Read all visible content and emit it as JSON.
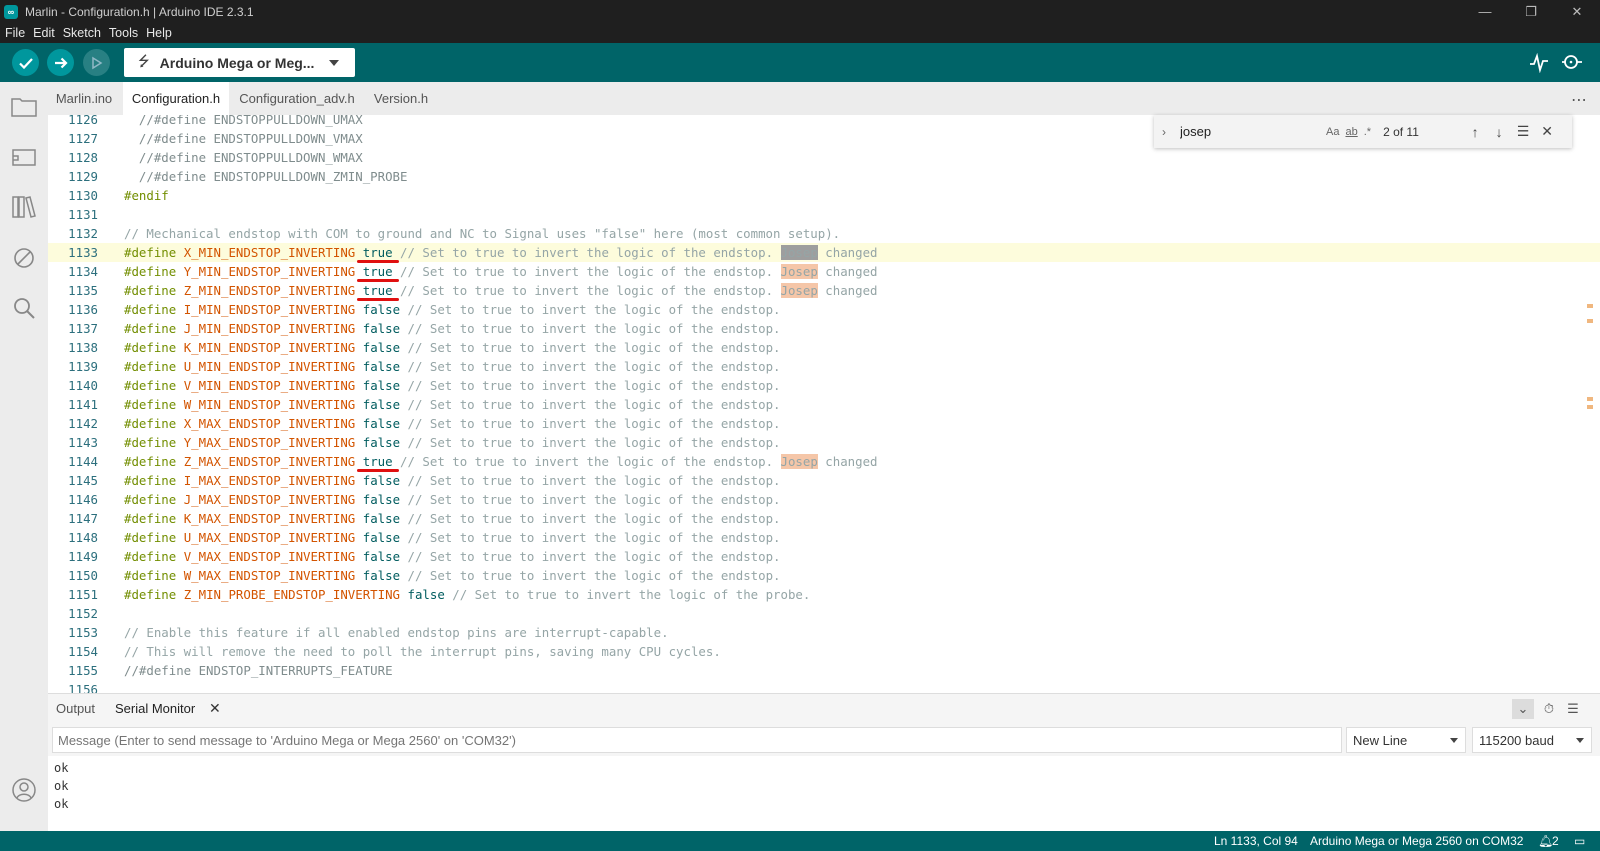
{
  "window": {
    "title": "Marlin - Configuration.h | Arduino IDE 2.3.1"
  },
  "menu": [
    "File",
    "Edit",
    "Sketch",
    "Tools",
    "Help"
  ],
  "toolbar": {
    "board": "Arduino Mega or Meg..."
  },
  "tabs": [
    "Marlin.ino",
    "Configuration.h",
    "Configuration_adv.h",
    "Version.h"
  ],
  "active_tab": "Configuration.h",
  "find": {
    "query": "josep",
    "count": "2 of 11",
    "case_label": "Aa",
    "word_label": "ab",
    "regex_label": ".*"
  },
  "editor": {
    "lines": [
      {
        "n": "1126",
        "segs": [
          {
            "t": "  //#define ENDSTOPPULLDOWN_UMAX",
            "c": "cmtd"
          }
        ]
      },
      {
        "n": "1127",
        "segs": [
          {
            "t": "  //#define ENDSTOPPULLDOWN_VMAX",
            "c": "cmtd"
          }
        ]
      },
      {
        "n": "1128",
        "segs": [
          {
            "t": "  //#define ENDSTOPPULLDOWN_WMAX",
            "c": "cmtd"
          }
        ]
      },
      {
        "n": "1129",
        "segs": [
          {
            "t": "  //#define ENDSTOPPULLDOWN_ZMIN_PROBE",
            "c": "cmtd"
          }
        ]
      },
      {
        "n": "1130",
        "segs": [
          {
            "t": "#endif",
            "c": "kw"
          }
        ]
      },
      {
        "n": "1131",
        "segs": []
      },
      {
        "n": "1132",
        "segs": [
          {
            "t": "// Mechanical endstop with COM to ground and NC to Signal uses \"false\" here (most common setup).",
            "c": "cmt"
          }
        ]
      },
      {
        "n": "1133",
        "cur": true,
        "segs": [
          {
            "t": "#define ",
            "c": "kw"
          },
          {
            "t": "X_MIN_ENDSTOP_INVERTING",
            "c": "ident"
          },
          {
            "t": " "
          },
          {
            "t": "true",
            "c": "val ul"
          },
          {
            "t": " // Set to true to invert the logic of the endstop. ",
            "c": "cmt"
          },
          {
            "t": "Josep",
            "c": "cmt hlcur"
          },
          {
            "t": " changed",
            "c": "cmt"
          }
        ]
      },
      {
        "n": "1134",
        "segs": [
          {
            "t": "#define ",
            "c": "kw"
          },
          {
            "t": "Y_MIN_ENDSTOP_INVERTING",
            "c": "ident"
          },
          {
            "t": " "
          },
          {
            "t": "true",
            "c": "val ul"
          },
          {
            "t": " // Set to true to invert the logic of the endstop. ",
            "c": "cmt"
          },
          {
            "t": "Josep",
            "c": "cmt hl"
          },
          {
            "t": " changed",
            "c": "cmt"
          }
        ]
      },
      {
        "n": "1135",
        "segs": [
          {
            "t": "#define ",
            "c": "kw"
          },
          {
            "t": "Z_MIN_ENDSTOP_INVERTING",
            "c": "ident"
          },
          {
            "t": " "
          },
          {
            "t": "true",
            "c": "val ul"
          },
          {
            "t": " // Set to true to invert the logic of the endstop. ",
            "c": "cmt"
          },
          {
            "t": "Josep",
            "c": "cmt hl"
          },
          {
            "t": " changed",
            "c": "cmt"
          }
        ]
      },
      {
        "n": "1136",
        "segs": [
          {
            "t": "#define ",
            "c": "kw"
          },
          {
            "t": "I_MIN_ENDSTOP_INVERTING",
            "c": "ident"
          },
          {
            "t": " "
          },
          {
            "t": "false",
            "c": "val"
          },
          {
            "t": " // Set to true to invert the logic of the endstop.",
            "c": "cmt"
          }
        ]
      },
      {
        "n": "1137",
        "segs": [
          {
            "t": "#define ",
            "c": "kw"
          },
          {
            "t": "J_MIN_ENDSTOP_INVERTING",
            "c": "ident"
          },
          {
            "t": " "
          },
          {
            "t": "false",
            "c": "val"
          },
          {
            "t": " // Set to true to invert the logic of the endstop.",
            "c": "cmt"
          }
        ]
      },
      {
        "n": "1138",
        "segs": [
          {
            "t": "#define ",
            "c": "kw"
          },
          {
            "t": "K_MIN_ENDSTOP_INVERTING",
            "c": "ident"
          },
          {
            "t": " "
          },
          {
            "t": "false",
            "c": "val"
          },
          {
            "t": " // Set to true to invert the logic of the endstop.",
            "c": "cmt"
          }
        ]
      },
      {
        "n": "1139",
        "segs": [
          {
            "t": "#define ",
            "c": "kw"
          },
          {
            "t": "U_MIN_ENDSTOP_INVERTING",
            "c": "ident"
          },
          {
            "t": " "
          },
          {
            "t": "false",
            "c": "val"
          },
          {
            "t": " // Set to true to invert the logic of the endstop.",
            "c": "cmt"
          }
        ]
      },
      {
        "n": "1140",
        "segs": [
          {
            "t": "#define ",
            "c": "kw"
          },
          {
            "t": "V_MIN_ENDSTOP_INVERTING",
            "c": "ident"
          },
          {
            "t": " "
          },
          {
            "t": "false",
            "c": "val"
          },
          {
            "t": " // Set to true to invert the logic of the endstop.",
            "c": "cmt"
          }
        ]
      },
      {
        "n": "1141",
        "segs": [
          {
            "t": "#define ",
            "c": "kw"
          },
          {
            "t": "W_MIN_ENDSTOP_INVERTING",
            "c": "ident"
          },
          {
            "t": " "
          },
          {
            "t": "false",
            "c": "val"
          },
          {
            "t": " // Set to true to invert the logic of the endstop.",
            "c": "cmt"
          }
        ]
      },
      {
        "n": "1142",
        "segs": [
          {
            "t": "#define ",
            "c": "kw"
          },
          {
            "t": "X_MAX_ENDSTOP_INVERTING",
            "c": "ident"
          },
          {
            "t": " "
          },
          {
            "t": "false",
            "c": "val"
          },
          {
            "t": " // Set to true to invert the logic of the endstop.",
            "c": "cmt"
          }
        ]
      },
      {
        "n": "1143",
        "segs": [
          {
            "t": "#define ",
            "c": "kw"
          },
          {
            "t": "Y_MAX_ENDSTOP_INVERTING",
            "c": "ident"
          },
          {
            "t": " "
          },
          {
            "t": "false",
            "c": "val"
          },
          {
            "t": " // Set to true to invert the logic of the endstop.",
            "c": "cmt"
          }
        ]
      },
      {
        "n": "1144",
        "segs": [
          {
            "t": "#define ",
            "c": "kw"
          },
          {
            "t": "Z_MAX_ENDSTOP_INVERTING",
            "c": "ident"
          },
          {
            "t": " "
          },
          {
            "t": "true",
            "c": "val ul"
          },
          {
            "t": " // Set to true to invert the logic of the endstop. ",
            "c": "cmt"
          },
          {
            "t": "Josep",
            "c": "cmt hl"
          },
          {
            "t": " changed",
            "c": "cmt"
          }
        ]
      },
      {
        "n": "1145",
        "segs": [
          {
            "t": "#define ",
            "c": "kw"
          },
          {
            "t": "I_MAX_ENDSTOP_INVERTING",
            "c": "ident"
          },
          {
            "t": " "
          },
          {
            "t": "false",
            "c": "val"
          },
          {
            "t": " // Set to true to invert the logic of the endstop.",
            "c": "cmt"
          }
        ]
      },
      {
        "n": "1146",
        "segs": [
          {
            "t": "#define ",
            "c": "kw"
          },
          {
            "t": "J_MAX_ENDSTOP_INVERTING",
            "c": "ident"
          },
          {
            "t": " "
          },
          {
            "t": "false",
            "c": "val"
          },
          {
            "t": " // Set to true to invert the logic of the endstop.",
            "c": "cmt"
          }
        ]
      },
      {
        "n": "1147",
        "segs": [
          {
            "t": "#define ",
            "c": "kw"
          },
          {
            "t": "K_MAX_ENDSTOP_INVERTING",
            "c": "ident"
          },
          {
            "t": " "
          },
          {
            "t": "false",
            "c": "val"
          },
          {
            "t": " // Set to true to invert the logic of the endstop.",
            "c": "cmt"
          }
        ]
      },
      {
        "n": "1148",
        "segs": [
          {
            "t": "#define ",
            "c": "kw"
          },
          {
            "t": "U_MAX_ENDSTOP_INVERTING",
            "c": "ident"
          },
          {
            "t": " "
          },
          {
            "t": "false",
            "c": "val"
          },
          {
            "t": " // Set to true to invert the logic of the endstop.",
            "c": "cmt"
          }
        ]
      },
      {
        "n": "1149",
        "segs": [
          {
            "t": "#define ",
            "c": "kw"
          },
          {
            "t": "V_MAX_ENDSTOP_INVERTING",
            "c": "ident"
          },
          {
            "t": " "
          },
          {
            "t": "false",
            "c": "val"
          },
          {
            "t": " // Set to true to invert the logic of the endstop.",
            "c": "cmt"
          }
        ]
      },
      {
        "n": "1150",
        "segs": [
          {
            "t": "#define ",
            "c": "kw"
          },
          {
            "t": "W_MAX_ENDSTOP_INVERTING",
            "c": "ident"
          },
          {
            "t": " "
          },
          {
            "t": "false",
            "c": "val"
          },
          {
            "t": " // Set to true to invert the logic of the endstop.",
            "c": "cmt"
          }
        ]
      },
      {
        "n": "1151",
        "segs": [
          {
            "t": "#define ",
            "c": "kw"
          },
          {
            "t": "Z_MIN_PROBE_ENDSTOP_INVERTING",
            "c": "ident"
          },
          {
            "t": " "
          },
          {
            "t": "false",
            "c": "val"
          },
          {
            "t": " // Set to true to invert the logic of the probe.",
            "c": "cmt"
          }
        ]
      },
      {
        "n": "1152",
        "segs": []
      },
      {
        "n": "1153",
        "segs": [
          {
            "t": "// Enable this feature if all enabled endstop pins are interrupt-capable.",
            "c": "cmt"
          }
        ]
      },
      {
        "n": "1154",
        "segs": [
          {
            "t": "// This will remove the need to poll the interrupt pins, saving many CPU cycles.",
            "c": "cmt"
          }
        ]
      },
      {
        "n": "1155",
        "segs": [
          {
            "t": "//#define ENDSTOP_INTERRUPTS_FEATURE",
            "c": "cmtd"
          }
        ]
      },
      {
        "n": "1156",
        "segs": []
      }
    ]
  },
  "panel": {
    "tabs": [
      "Output",
      "Serial Monitor"
    ],
    "message_placeholder": "Message (Enter to send message to 'Arduino Mega or Mega 2560' on 'COM32')",
    "line_ending": "New Line",
    "baud": "115200 baud",
    "output": [
      "ok",
      "ok",
      "ok"
    ]
  },
  "status": {
    "position": "Ln 1133, Col 94",
    "board": "Arduino Mega or Mega 2560 on COM32",
    "notifications": "2"
  },
  "colors": {
    "toolbar": "#006468",
    "accent": "#00979d",
    "highlight": "#f5c6a8",
    "underline": "#e01010"
  }
}
